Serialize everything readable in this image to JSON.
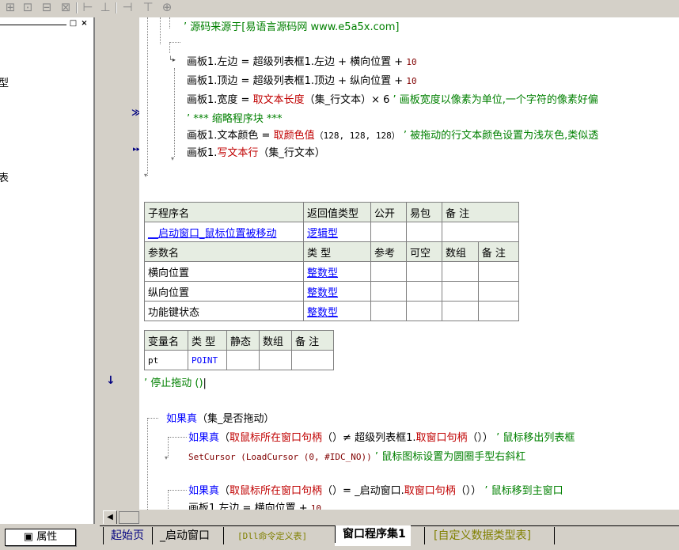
{
  "toolbar": {
    "icons": [
      "grid-icon",
      "grid-fill-icon",
      "grid-cross-icon",
      "grid-split-icon",
      "align-h-icon",
      "align-v-icon",
      "same-width-icon",
      "same-height-icon",
      "same-size-icon"
    ]
  },
  "left_panel": {
    "title_buttons": [
      "□",
      "×"
    ],
    "items": [
      "型",
      "表"
    ],
    "properties_tab": "属性"
  },
  "gutter": {
    "markers": [
      "≫",
      "▸▸",
      "↓"
    ]
  },
  "code_top": {
    "line_source": "’ 源码来源于[易语言源码网 www.e5a5x.com]",
    "line1": [
      "画板1.左边",
      " = ",
      "超级列表框1.左边",
      " + ",
      "横向位置",
      " + ",
      "10"
    ],
    "line2": [
      "画板1.顶边",
      " = ",
      "超级列表框1.顶边",
      " + ",
      "纵向位置",
      " + ",
      "10"
    ],
    "line3": [
      "画板1.宽度",
      " = ",
      "取文本长度",
      "（集_行文本）× 6",
      " ’ 画板宽度以像素为单位,一个字符的像素好偏"
    ],
    "line4": "’ *** 缩略程序块 ***",
    "line5": [
      "画板1.文本颜色",
      " = ",
      "取颜色值",
      "（128, 128, 128）",
      " ’ 被拖动的行文本颜色设置为浅灰色,类似透"
    ],
    "line6": [
      "画板1.",
      "写文本行",
      "（集_行文本）"
    ]
  },
  "sub_table": {
    "headers": [
      "子程序名",
      "返回值类型",
      "公开",
      "易包",
      "备 注"
    ],
    "row": [
      "__启动窗口_鼠标位置被移动",
      "逻辑型",
      "",
      "",
      ""
    ],
    "param_headers": [
      "参数名",
      "类 型",
      "参考",
      "可空",
      "数组",
      "备 注"
    ],
    "params": [
      [
        "横向位置",
        "整数型"
      ],
      [
        "纵向位置",
        "整数型"
      ],
      [
        "功能键状态",
        "整数型"
      ]
    ]
  },
  "var_table": {
    "headers": [
      "变量名",
      "类 型",
      "静态",
      "数组",
      "备 注"
    ],
    "row": [
      "pt",
      "POINT",
      "",
      "",
      ""
    ]
  },
  "code_bottom": {
    "stop_drag": "’ 停止拖动 ()",
    "if1": [
      "如果真",
      "（集_是否拖动）"
    ],
    "if2": [
      "如果真",
      "（",
      "取鼠标所在窗口句柄",
      "（）≠ ",
      "超级列表框1.",
      "取窗口句柄",
      "（））",
      " ’ 鼠标移出列表框"
    ],
    "setcursor": [
      "SetCursor (LoadCursor (0, #IDC_NO))",
      " ’ 鼠标图标设置为圆圈手型右斜杠"
    ],
    "if3": [
      "如果真",
      "（",
      "取鼠标所在窗口句柄",
      "（）= ",
      "_启动窗口.",
      "取窗口句柄",
      "（））",
      " ’ 鼠标移到主窗口"
    ],
    "last_line": [
      "画板1.左边",
      " = ",
      "横向位置",
      " + ",
      "10"
    ]
  },
  "tabs": [
    "起始页",
    "_启动窗口",
    "[Dll命令定义表]",
    "窗口程序集1",
    "[自定义数据类型表]"
  ],
  "colors": {
    "comment": "#008000",
    "keyword": "#c00000",
    "type_link": "#0000ff",
    "header_bg": "#e6ede2"
  }
}
